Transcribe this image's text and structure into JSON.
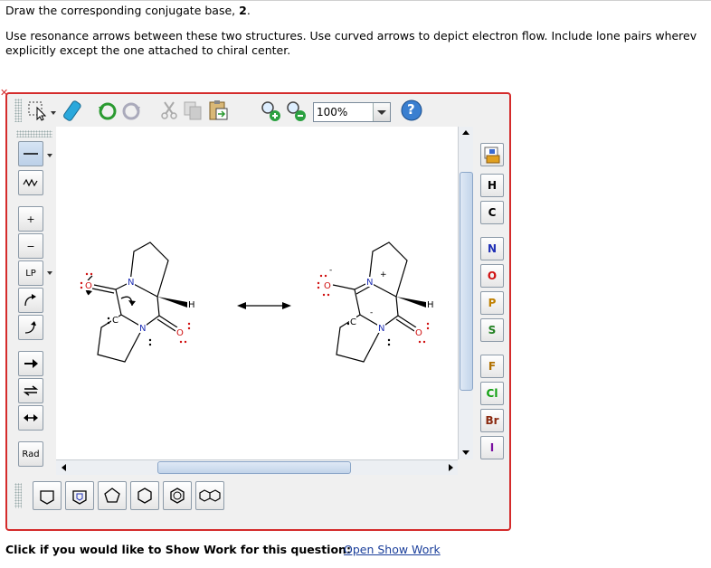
{
  "question": {
    "line1_prefix": "Draw the corresponding conjugate base, ",
    "line1_bold": "2",
    "line1_suffix": ".",
    "line2": "Use resonance arrows between these two structures. Use curved arrows to depict electron flow. Include lone pairs wherev",
    "line3": "explicitly except the one attached to chiral center."
  },
  "toolbar": {
    "zoom_value": "100%",
    "icons": [
      "select-icon",
      "eraser-icon",
      "undo-icon",
      "redo-icon",
      "cut-icon",
      "copy-icon",
      "paste-icon",
      "zoom-in-icon",
      "zoom-out-icon",
      "help-icon"
    ],
    "help_label": "?"
  },
  "left_tools": {
    "charge_plus": "+",
    "charge_minus": "−",
    "lone_pair": "LP",
    "radical": "Rad"
  },
  "elements": [
    "H",
    "C",
    "N",
    "O",
    "P",
    "S",
    "F",
    "Cl",
    "Br",
    "I"
  ],
  "element_colors": {
    "H": "#000000",
    "C": "#000000",
    "N": "#1f2fb5",
    "O": "#d01010",
    "P": "#c08000",
    "S": "#208020",
    "F": "#b07000",
    "Cl": "#10a010",
    "Br": "#8a2a10",
    "I": "#7a10a0"
  },
  "molecule_labels": {
    "N": "N",
    "O": "O",
    "C": "C",
    "H": "H",
    "charge_plus": "+",
    "charge_minus": "-"
  },
  "footer": {
    "prompt": "Click if you would like to Show Work for this question:",
    "link": "Open Show Work"
  }
}
